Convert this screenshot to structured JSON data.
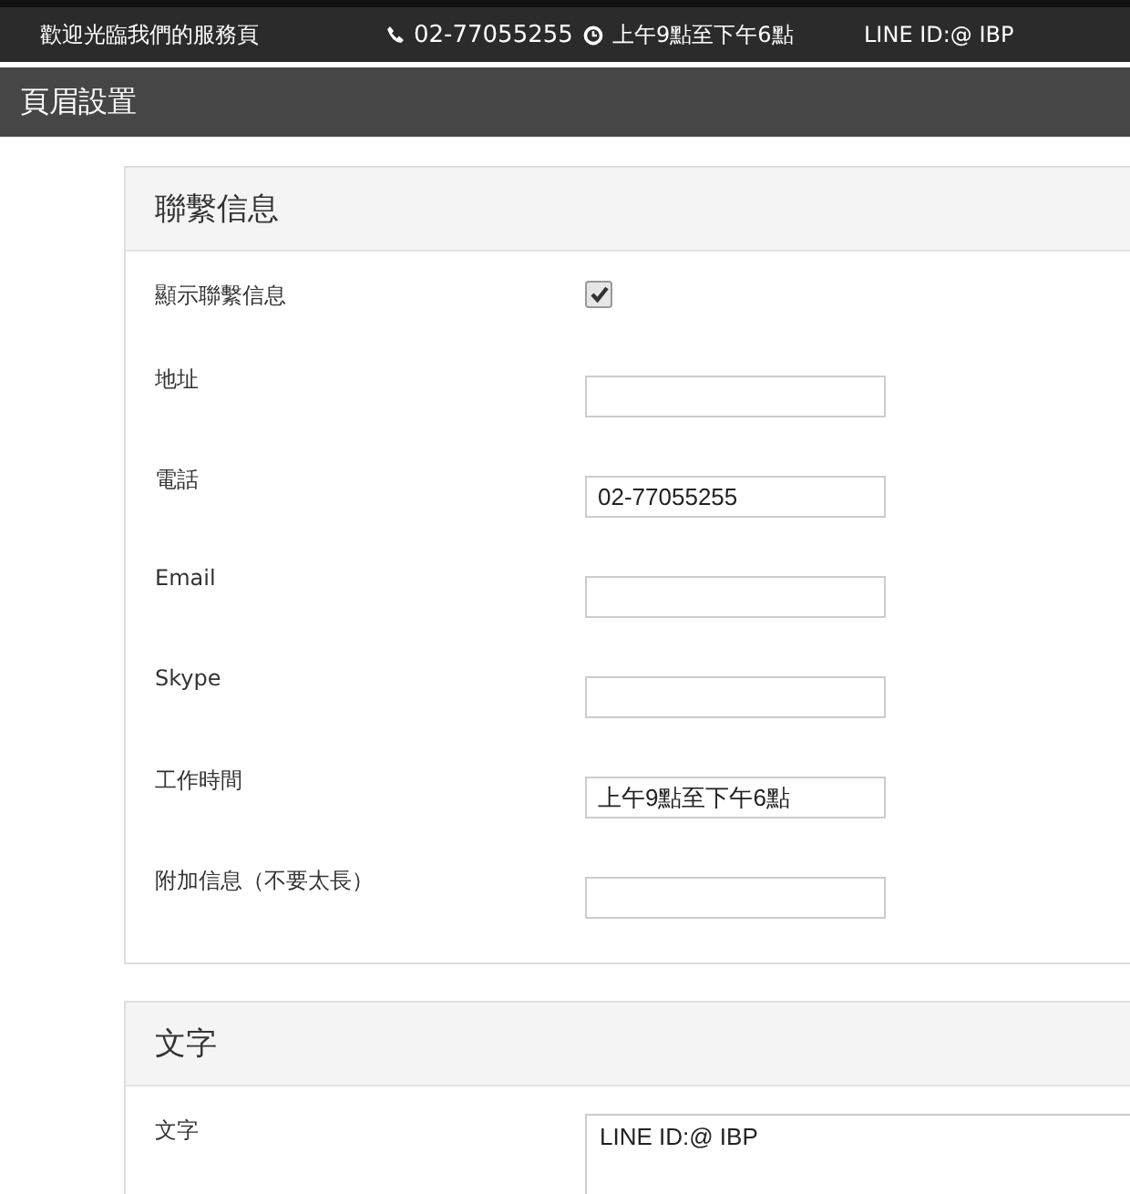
{
  "top_bar": {
    "welcome": "歡迎光臨我們的服務頁",
    "phone": "02-77055255",
    "hours": "上午9點至下午6點",
    "line_id": "LINE ID:@ IBP"
  },
  "page_title": "頁眉設置",
  "panels": [
    {
      "title": "聯繫信息",
      "fields": [
        {
          "kind": "checkbox",
          "label": "顯示聯繫信息",
          "checked": true
        },
        {
          "kind": "text",
          "label": "地址"
        },
        {
          "kind": "text",
          "label": "電話",
          "value": "02-77055255"
        },
        {
          "kind": "text",
          "label": "Email"
        },
        {
          "kind": "text",
          "label": "Skype"
        },
        {
          "kind": "text",
          "label": "工作時間",
          "value": "上午9點至下午6點"
        },
        {
          "kind": "text",
          "label": "附加信息（不要太長）"
        }
      ]
    },
    {
      "title": "文字",
      "fields": [
        {
          "kind": "textarea",
          "label": "文字",
          "value": "LINE ID:@ IBP"
        }
      ]
    }
  ]
}
